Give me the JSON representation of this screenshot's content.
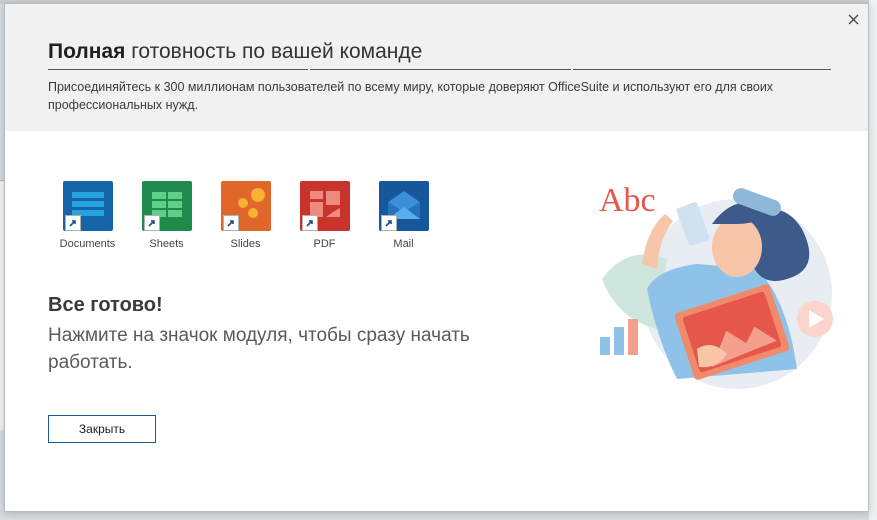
{
  "dialog": {
    "title_bold": "Полная",
    "title_rest": "готовность по вашей команде",
    "subtitle": "Присоединяйтесь к 300 миллионам пользователей по всему миру, которые доверяют OfficeSuite и используют его для своих профессиональных нужд.",
    "close_icon": "close-icon"
  },
  "apps": [
    {
      "label": "Documents",
      "icon": "documents-icon",
      "color": "#1565a8"
    },
    {
      "label": "Sheets",
      "icon": "sheets-icon",
      "color": "#1f8a4c"
    },
    {
      "label": "Slides",
      "icon": "slides-icon",
      "color": "#e0662a"
    },
    {
      "label": "PDF",
      "icon": "pdf-icon",
      "color": "#c8342b"
    },
    {
      "label": "Mail",
      "icon": "mail-icon",
      "color": "#16569a"
    }
  ],
  "ready": {
    "title": "Все готово!",
    "text": "Нажмите на значок модуля, чтобы сразу начать работать."
  },
  "actions": {
    "close_label": "Закрыть"
  },
  "illustration": {
    "text": "Abc",
    "colors": {
      "accent": "#e6564a",
      "skin": "#f7c6a8",
      "hair": "#3d5a8a",
      "bg": "#e8edf3"
    }
  }
}
